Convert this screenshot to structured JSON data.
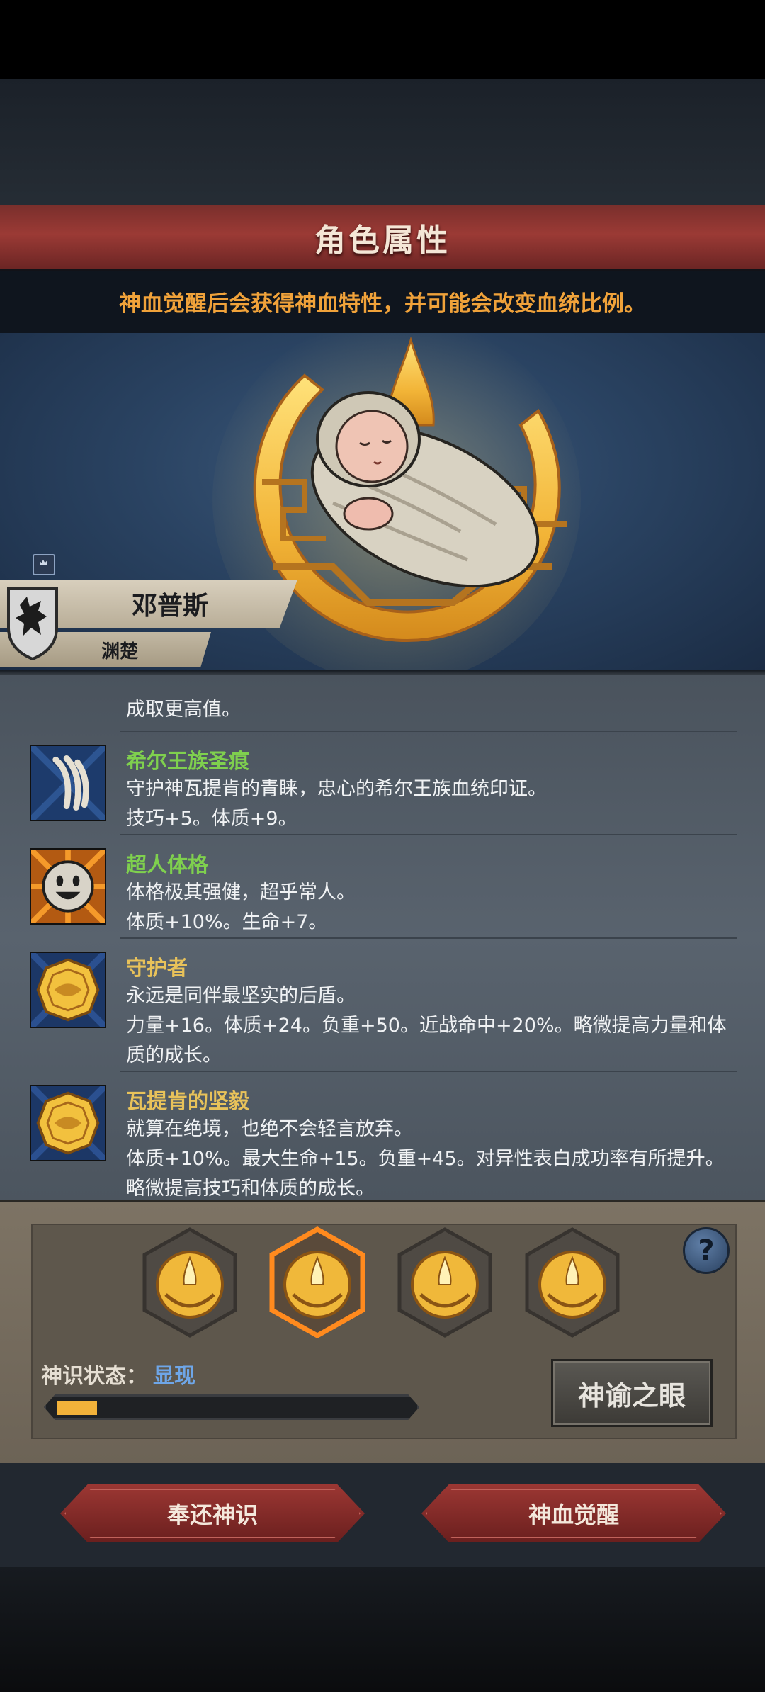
{
  "header": {
    "title": "角色属性",
    "subtitle": "神血觉醒后会获得神血特性，并可能会改变血统比例。"
  },
  "character": {
    "name": "邓普斯",
    "faction": "渊楚"
  },
  "traits": [
    {
      "partial": true,
      "lines": [
        "成取更高值。"
      ]
    },
    {
      "name": "希尔王族圣痕",
      "name_color": "#7fd04e",
      "icon": "claw-mark-icon",
      "lines": [
        "守护神瓦提肯的青睐，忠心的希尔王族血统印证。",
        "技巧+5。体质+9。"
      ]
    },
    {
      "name": "超人体格",
      "name_color": "#7fd04e",
      "icon": "smiley-face-icon",
      "lines": [
        "体格极其强健，超乎常人。",
        "体质+10%。生命+7。"
      ]
    },
    {
      "name": "守护者",
      "name_color": "#e8c25a",
      "icon": "golden-emblem-icon",
      "lines": [
        "永远是同伴最坚实的后盾。",
        "力量+16。体质+24。负重+50。近战命中+20%。略微提高力量和体",
        "质的成长。"
      ]
    },
    {
      "name": "瓦提肯的坚毅",
      "name_color": "#e8c25a",
      "icon": "golden-emblem-icon",
      "lines": [
        "就算在绝境，也绝不会轻言放弃。",
        "体质+10%。最大生命+15。负重+45。对异性表白成功率有所提升。",
        "略微提高技巧和体质的成长。"
      ]
    }
  ],
  "awakening": {
    "slots": [
      {
        "icon": "divine-crescent-icon",
        "selected": false
      },
      {
        "icon": "divine-crescent-icon",
        "selected": true
      },
      {
        "icon": "divine-crescent-icon",
        "selected": false
      },
      {
        "icon": "divine-crescent-icon",
        "selected": false
      }
    ],
    "state_label": "神识状态：",
    "state_value": "显现",
    "progress": 0.08,
    "eye_button": "神谕之眼",
    "help_icon": "question-icon"
  },
  "buttons": {
    "return": "奉还神识",
    "awaken": "神血觉醒"
  },
  "colors": {
    "title_bar": "#8f3531",
    "subtitle_text": "#f0a23a",
    "selected_glow": "#ff8a1e",
    "progress_fill": "#f2b23a",
    "state_value": "#6ea6e8"
  }
}
